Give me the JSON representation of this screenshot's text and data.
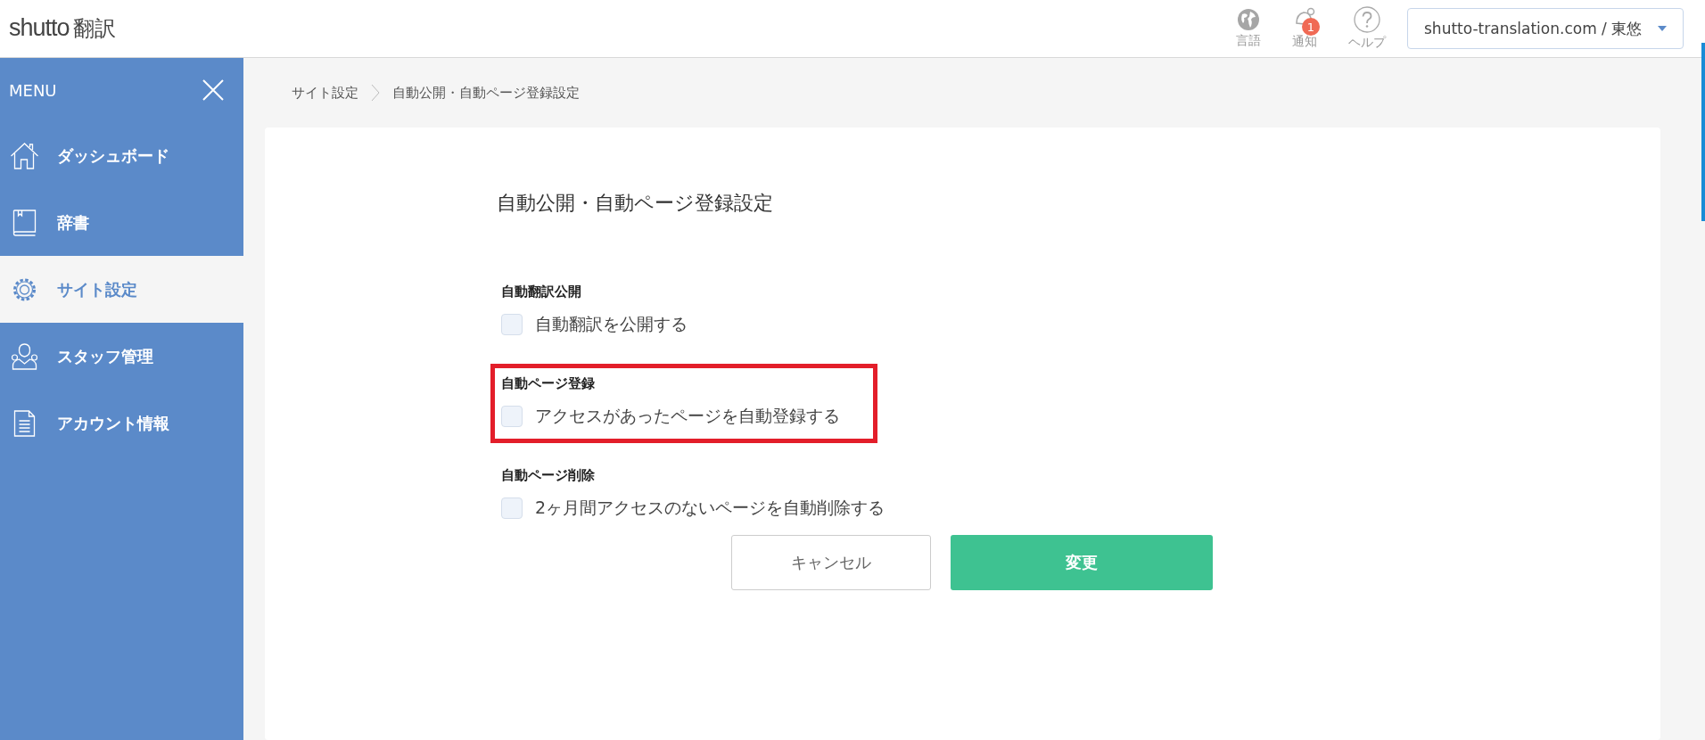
{
  "header": {
    "logo_text": "shutto",
    "logo_suffix": "翻訳",
    "icons": [
      {
        "kind": "globe",
        "label": "言語"
      },
      {
        "kind": "bell",
        "label": "通知",
        "badge": "1"
      },
      {
        "kind": "help",
        "label": "ヘルプ"
      }
    ],
    "account_select": {
      "value": "shutto-translation.com / 東悠"
    }
  },
  "sidebar": {
    "title": "MENU",
    "items": [
      {
        "kind": "home",
        "label": "ダッシュボード",
        "selected": false
      },
      {
        "kind": "book",
        "label": "辞書",
        "selected": false
      },
      {
        "kind": "gear",
        "label": "サイト設定",
        "selected": true
      },
      {
        "kind": "staff",
        "label": "スタッフ管理",
        "selected": false
      },
      {
        "kind": "document",
        "label": "アカウント情報",
        "selected": false
      }
    ]
  },
  "breadcrumb": [
    "サイト設定",
    "自動公開・自動ページ登録設定"
  ],
  "form": {
    "title": "自動公開・自動ページ登録設定",
    "sections": [
      {
        "heading": "自動翻訳公開",
        "option": "自動翻訳を公開する",
        "checked": false,
        "highlighted": false
      },
      {
        "heading": "自動ページ登録",
        "option": "アクセスがあったページを自動登録する",
        "checked": false,
        "highlighted": true
      },
      {
        "heading": "自動ページ削除",
        "option": "2ヶ月間アクセスのないページを自動削除する",
        "checked": false,
        "highlighted": false
      }
    ],
    "buttons": [
      {
        "kind": "secondary",
        "label": "キャンセル"
      },
      {
        "kind": "primary",
        "label": "変更"
      }
    ]
  }
}
